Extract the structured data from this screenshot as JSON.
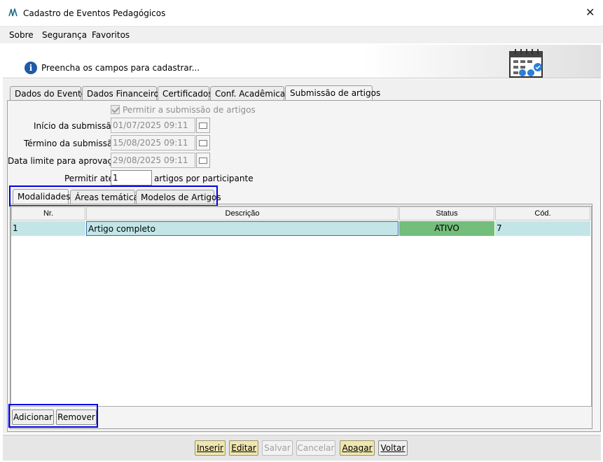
{
  "window": {
    "title": "Cadastro de Eventos Pedagógicos",
    "close_glyph": "✕"
  },
  "menu": {
    "items": [
      "Sobre",
      "Segurança",
      "Favoritos"
    ]
  },
  "banner": {
    "message": "Preencha os campos para cadastrar...",
    "info_glyph": "i"
  },
  "tabs": {
    "items": [
      "Dados do Evento",
      "Dados Financeiros",
      "Certificados",
      "Conf. Acadêmicas",
      "Submissão de artigos"
    ],
    "active": "Submissão de artigos"
  },
  "form": {
    "allow_submission_label": "Permitir a submissão de artigos",
    "allow_submission_checked": true,
    "start_label": "Início da submissão:",
    "start_value": "01/07/2025 09:11",
    "end_label": "Término da submissão:",
    "end_value": "15/08/2025 09:11",
    "approval_label": "Data limite para aprovação:",
    "approval_value": "29/08/2025 09:11",
    "allow_until_label": "Permitir até:",
    "allow_until_value": "1",
    "per_participant_label": "artigos por participante"
  },
  "subtabs": {
    "items": [
      "Modalidades",
      "Áreas temáticas",
      "Modelos de Artigos"
    ],
    "active": "Modalidades"
  },
  "table": {
    "columns": [
      "Nr.",
      "Descrição",
      "Status",
      "Cód."
    ],
    "rows": [
      {
        "nr": "1",
        "descricao": "Artigo completo",
        "status": "ATIVO",
        "cod": "7"
      }
    ]
  },
  "list_buttons": {
    "add": "Adicionar",
    "remove": "Remover"
  },
  "footer_buttons": {
    "insert": "Inserir",
    "edit": "Editar",
    "save": "Salvar",
    "cancel": "Cancelar",
    "delete": "Apagar",
    "back": "Voltar"
  },
  "colors": {
    "status_active_bg": "#72be7a",
    "row_bg": "#c2e6e8",
    "highlight_border": "#0000e6",
    "yellow_button": "#efe6b0",
    "info_icon": "#1e5aa8"
  },
  "icons": {
    "app": "app-logo-icon",
    "info": "info-icon",
    "calendar": "calendar-icon",
    "date_picker": "date-picker-icon"
  }
}
